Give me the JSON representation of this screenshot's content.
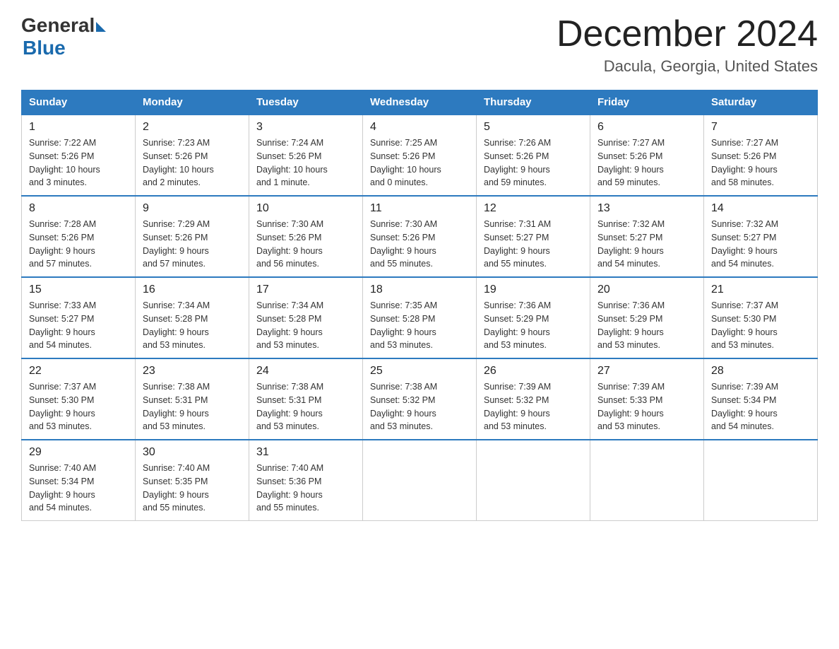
{
  "logo": {
    "general": "General",
    "blue": "Blue"
  },
  "title": {
    "month": "December 2024",
    "location": "Dacula, Georgia, United States"
  },
  "days_of_week": [
    "Sunday",
    "Monday",
    "Tuesday",
    "Wednesday",
    "Thursday",
    "Friday",
    "Saturday"
  ],
  "weeks": [
    [
      {
        "day": "1",
        "sunrise": "7:22 AM",
        "sunset": "5:26 PM",
        "daylight": "10 hours and 3 minutes."
      },
      {
        "day": "2",
        "sunrise": "7:23 AM",
        "sunset": "5:26 PM",
        "daylight": "10 hours and 2 minutes."
      },
      {
        "day": "3",
        "sunrise": "7:24 AM",
        "sunset": "5:26 PM",
        "daylight": "10 hours and 1 minute."
      },
      {
        "day": "4",
        "sunrise": "7:25 AM",
        "sunset": "5:26 PM",
        "daylight": "10 hours and 0 minutes."
      },
      {
        "day": "5",
        "sunrise": "7:26 AM",
        "sunset": "5:26 PM",
        "daylight": "9 hours and 59 minutes."
      },
      {
        "day": "6",
        "sunrise": "7:27 AM",
        "sunset": "5:26 PM",
        "daylight": "9 hours and 59 minutes."
      },
      {
        "day": "7",
        "sunrise": "7:27 AM",
        "sunset": "5:26 PM",
        "daylight": "9 hours and 58 minutes."
      }
    ],
    [
      {
        "day": "8",
        "sunrise": "7:28 AM",
        "sunset": "5:26 PM",
        "daylight": "9 hours and 57 minutes."
      },
      {
        "day": "9",
        "sunrise": "7:29 AM",
        "sunset": "5:26 PM",
        "daylight": "9 hours and 57 minutes."
      },
      {
        "day": "10",
        "sunrise": "7:30 AM",
        "sunset": "5:26 PM",
        "daylight": "9 hours and 56 minutes."
      },
      {
        "day": "11",
        "sunrise": "7:30 AM",
        "sunset": "5:26 PM",
        "daylight": "9 hours and 55 minutes."
      },
      {
        "day": "12",
        "sunrise": "7:31 AM",
        "sunset": "5:27 PM",
        "daylight": "9 hours and 55 minutes."
      },
      {
        "day": "13",
        "sunrise": "7:32 AM",
        "sunset": "5:27 PM",
        "daylight": "9 hours and 54 minutes."
      },
      {
        "day": "14",
        "sunrise": "7:32 AM",
        "sunset": "5:27 PM",
        "daylight": "9 hours and 54 minutes."
      }
    ],
    [
      {
        "day": "15",
        "sunrise": "7:33 AM",
        "sunset": "5:27 PM",
        "daylight": "9 hours and 54 minutes."
      },
      {
        "day": "16",
        "sunrise": "7:34 AM",
        "sunset": "5:28 PM",
        "daylight": "9 hours and 53 minutes."
      },
      {
        "day": "17",
        "sunrise": "7:34 AM",
        "sunset": "5:28 PM",
        "daylight": "9 hours and 53 minutes."
      },
      {
        "day": "18",
        "sunrise": "7:35 AM",
        "sunset": "5:28 PM",
        "daylight": "9 hours and 53 minutes."
      },
      {
        "day": "19",
        "sunrise": "7:36 AM",
        "sunset": "5:29 PM",
        "daylight": "9 hours and 53 minutes."
      },
      {
        "day": "20",
        "sunrise": "7:36 AM",
        "sunset": "5:29 PM",
        "daylight": "9 hours and 53 minutes."
      },
      {
        "day": "21",
        "sunrise": "7:37 AM",
        "sunset": "5:30 PM",
        "daylight": "9 hours and 53 minutes."
      }
    ],
    [
      {
        "day": "22",
        "sunrise": "7:37 AM",
        "sunset": "5:30 PM",
        "daylight": "9 hours and 53 minutes."
      },
      {
        "day": "23",
        "sunrise": "7:38 AM",
        "sunset": "5:31 PM",
        "daylight": "9 hours and 53 minutes."
      },
      {
        "day": "24",
        "sunrise": "7:38 AM",
        "sunset": "5:31 PM",
        "daylight": "9 hours and 53 minutes."
      },
      {
        "day": "25",
        "sunrise": "7:38 AM",
        "sunset": "5:32 PM",
        "daylight": "9 hours and 53 minutes."
      },
      {
        "day": "26",
        "sunrise": "7:39 AM",
        "sunset": "5:32 PM",
        "daylight": "9 hours and 53 minutes."
      },
      {
        "day": "27",
        "sunrise": "7:39 AM",
        "sunset": "5:33 PM",
        "daylight": "9 hours and 53 minutes."
      },
      {
        "day": "28",
        "sunrise": "7:39 AM",
        "sunset": "5:34 PM",
        "daylight": "9 hours and 54 minutes."
      }
    ],
    [
      {
        "day": "29",
        "sunrise": "7:40 AM",
        "sunset": "5:34 PM",
        "daylight": "9 hours and 54 minutes."
      },
      {
        "day": "30",
        "sunrise": "7:40 AM",
        "sunset": "5:35 PM",
        "daylight": "9 hours and 55 minutes."
      },
      {
        "day": "31",
        "sunrise": "7:40 AM",
        "sunset": "5:36 PM",
        "daylight": "9 hours and 55 minutes."
      },
      null,
      null,
      null,
      null
    ]
  ],
  "labels": {
    "sunrise": "Sunrise:",
    "sunset": "Sunset:",
    "daylight": "Daylight:"
  }
}
